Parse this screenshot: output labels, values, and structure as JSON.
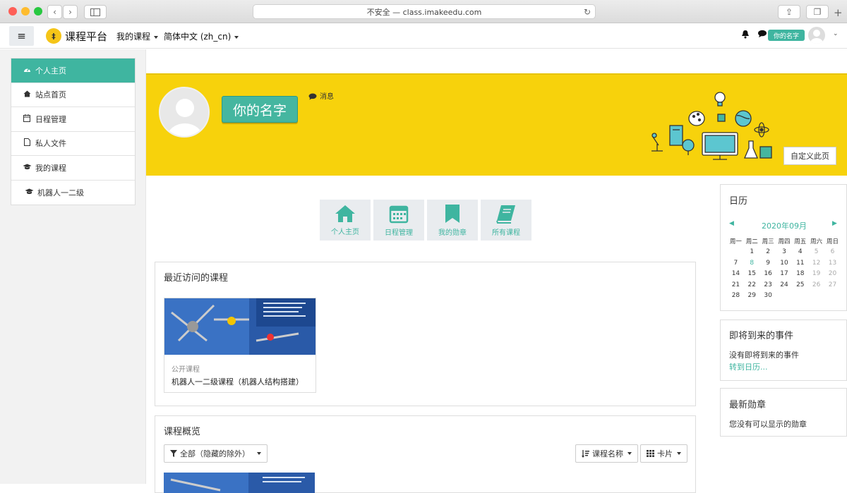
{
  "browser": {
    "address": "不安全 — class.imakeedu.com"
  },
  "navbar": {
    "brand": "课程平台",
    "logo_text": "‡",
    "my_courses": "我的课程",
    "language": "简体中文 (zh_cn)",
    "user_badge": "你的名字"
  },
  "sidebar": {
    "items": [
      {
        "label": "个人主页",
        "icon": "dashboard-icon"
      },
      {
        "label": "站点首页",
        "icon": "home-icon"
      },
      {
        "label": "日程管理",
        "icon": "calendar-icon"
      },
      {
        "label": "私人文件",
        "icon": "file-icon"
      },
      {
        "label": "我的课程",
        "icon": "graduation-cap-icon"
      },
      {
        "label": "机器人一二级",
        "icon": "graduation-cap-icon"
      }
    ]
  },
  "header": {
    "user_name": "你的名字",
    "message": "消息",
    "customize": "自定义此页"
  },
  "tiles": [
    {
      "label": "个人主页",
      "icon": "home-icon"
    },
    {
      "label": "日程管理",
      "icon": "calendar-icon"
    },
    {
      "label": "我的勋章",
      "icon": "bookmark-icon"
    },
    {
      "label": "所有课程",
      "icon": "book-icon"
    }
  ],
  "recent": {
    "title": "最近访问的课程",
    "course": {
      "category": "公开课程",
      "name": "机器人一二级课程（机器人结构搭建）"
    }
  },
  "overview": {
    "title": "课程概览",
    "filter": "全部（隐藏的除外）",
    "sort": "课程名称",
    "view": "卡片"
  },
  "calendar": {
    "title": "日历",
    "month": "2020年09月",
    "weekdays": [
      "周一",
      "周二",
      "周三",
      "周四",
      "周五",
      "周六",
      "周日"
    ],
    "weeks": [
      [
        "",
        "1",
        "2",
        "3",
        "4",
        "5",
        "6"
      ],
      [
        "7",
        "8",
        "9",
        "10",
        "11",
        "12",
        "13"
      ],
      [
        "14",
        "15",
        "16",
        "17",
        "18",
        "19",
        "20"
      ],
      [
        "21",
        "22",
        "23",
        "24",
        "25",
        "26",
        "27"
      ],
      [
        "28",
        "29",
        "30",
        "",
        "",
        "",
        ""
      ]
    ],
    "today": "8"
  },
  "upcoming": {
    "title": "即将到来的事件",
    "empty": "没有即将到来的事件",
    "link": "转到日历..."
  },
  "badges": {
    "title": "最新勋章",
    "empty": "您没有可以显示的勋章"
  },
  "colors": {
    "accent": "#3fb5a0",
    "header_bg": "#f7d20c"
  }
}
